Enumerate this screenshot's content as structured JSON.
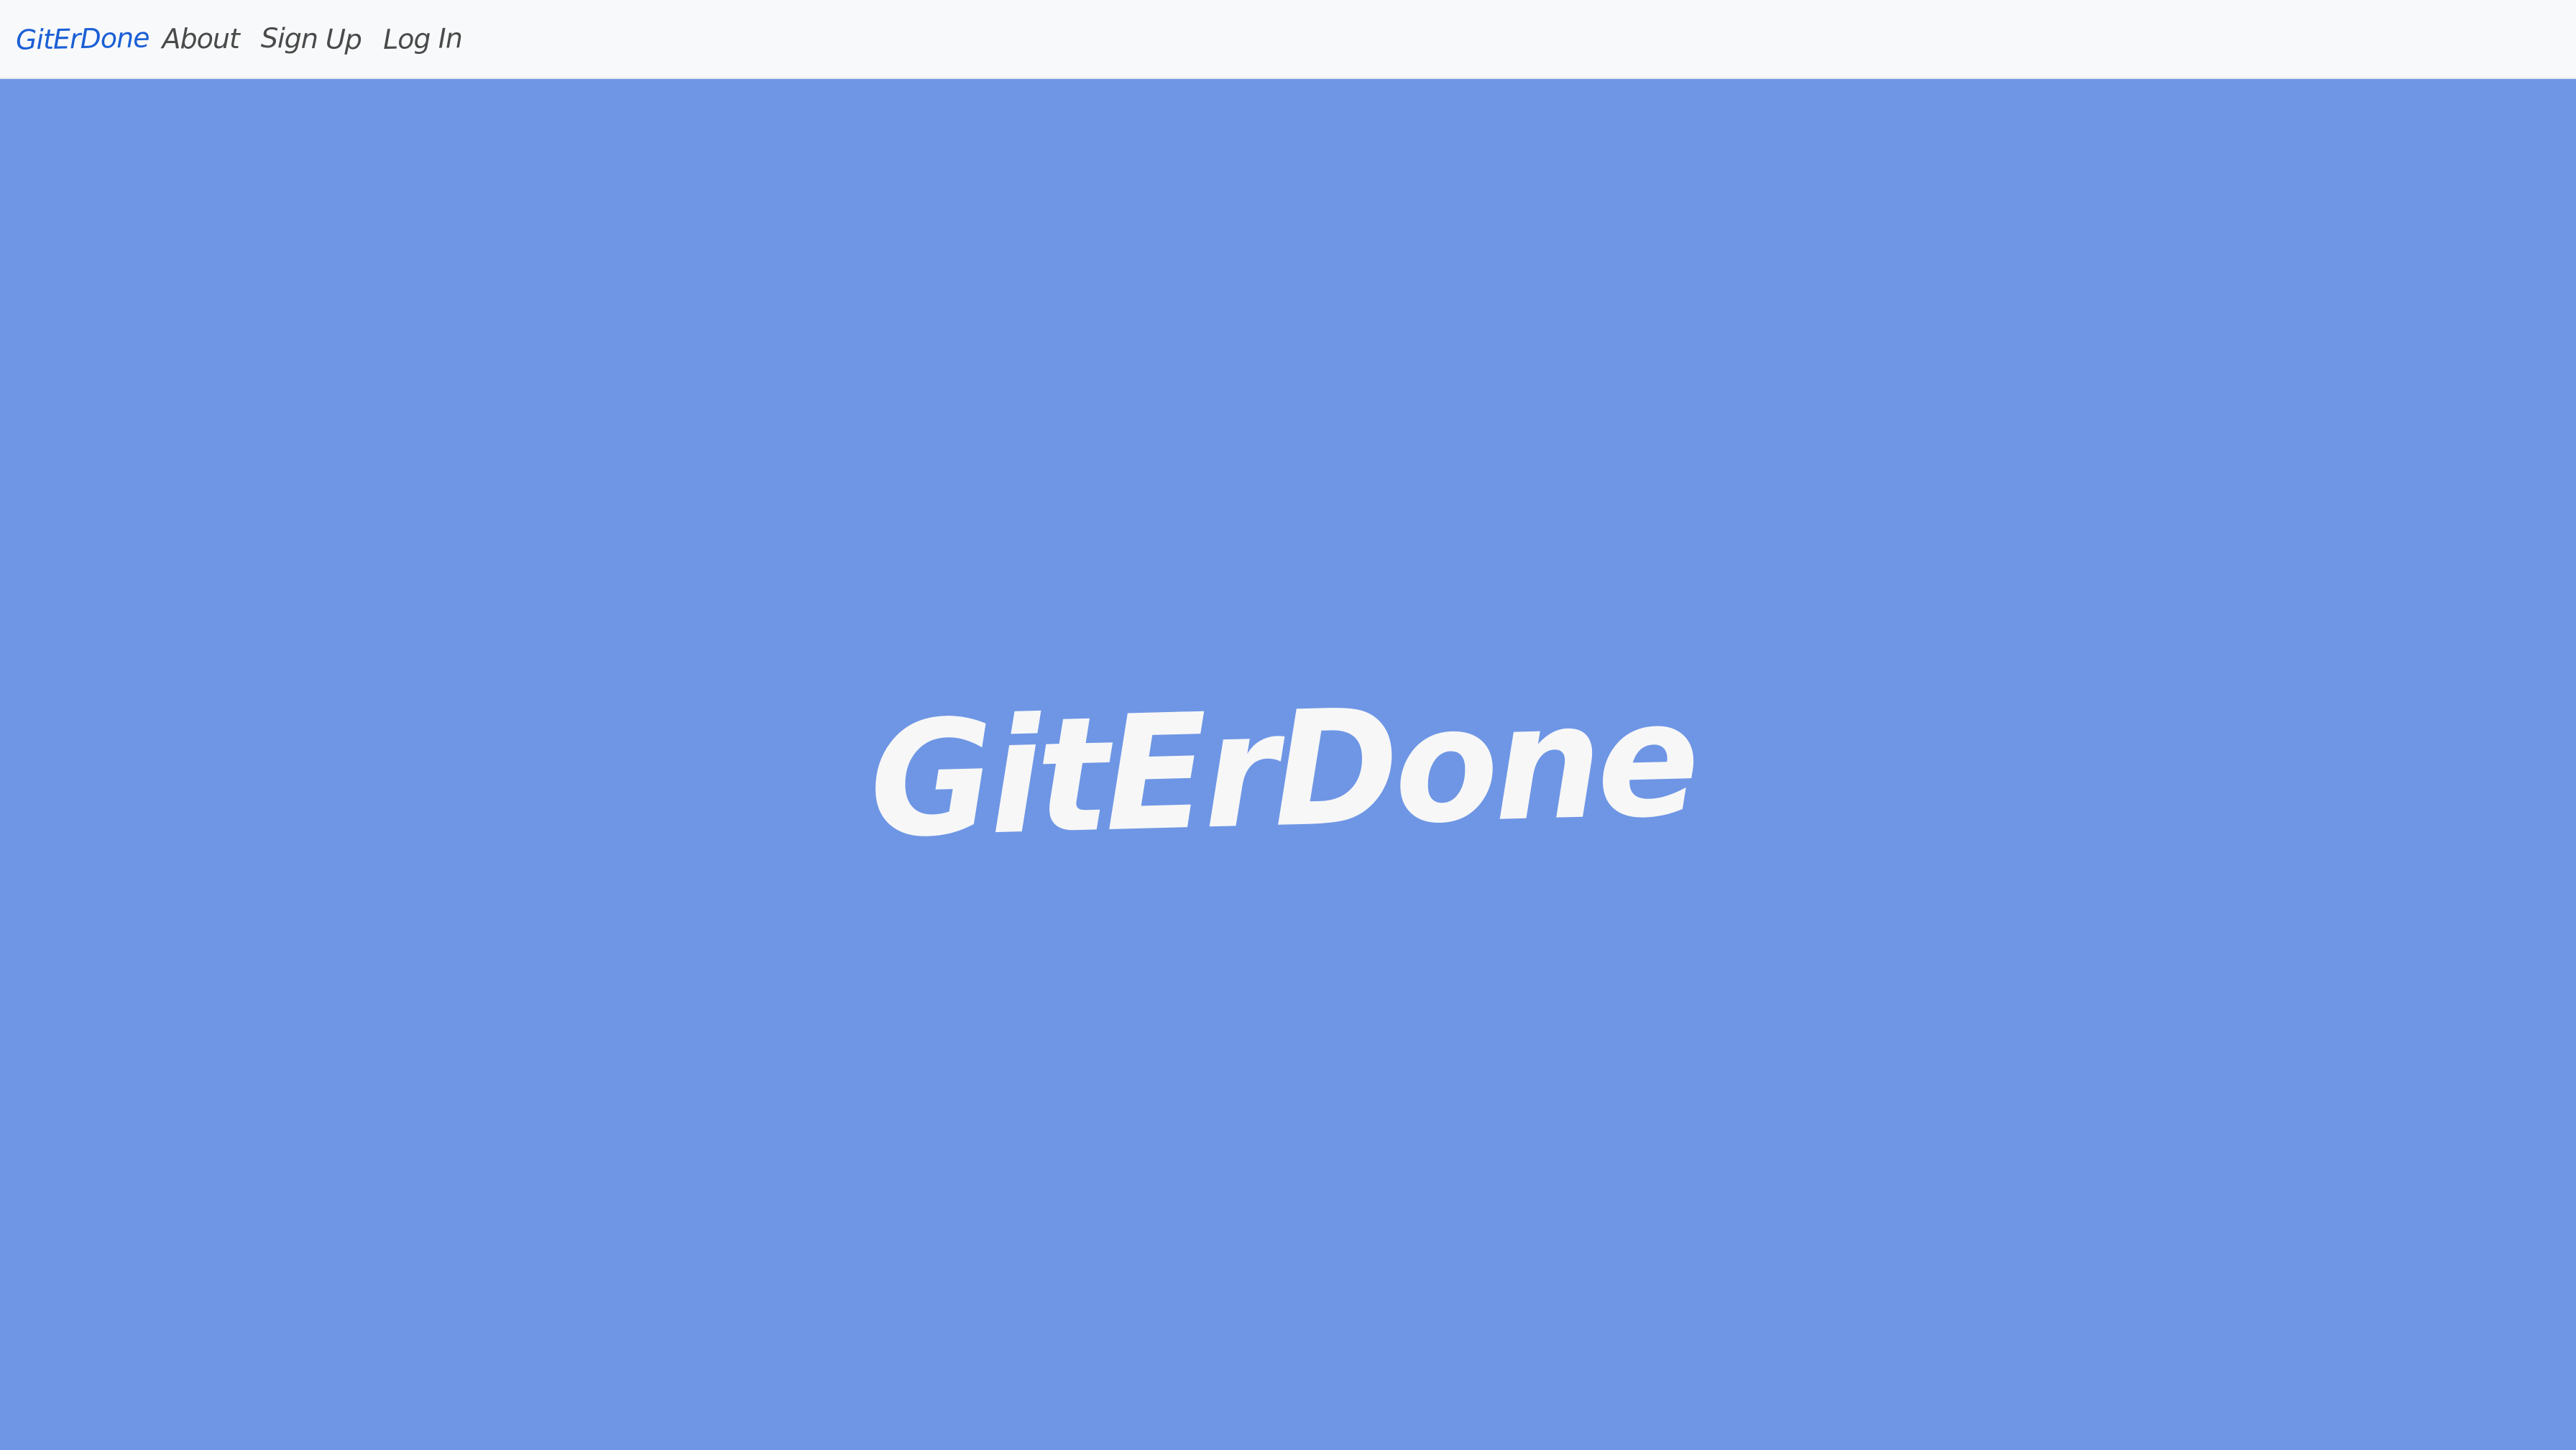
{
  "nav": {
    "brand": "GitErDone",
    "links": [
      {
        "label": "About"
      },
      {
        "label": "Sign Up"
      },
      {
        "label": "Log In"
      }
    ]
  },
  "hero": {
    "title": "GitErDone"
  },
  "colors": {
    "background": "#6e96e5",
    "navbar": "#f8f9fa",
    "brand": "#1a5fd6",
    "nav_text": "#4a4a4a",
    "hero_text": "#f7f7f7"
  }
}
